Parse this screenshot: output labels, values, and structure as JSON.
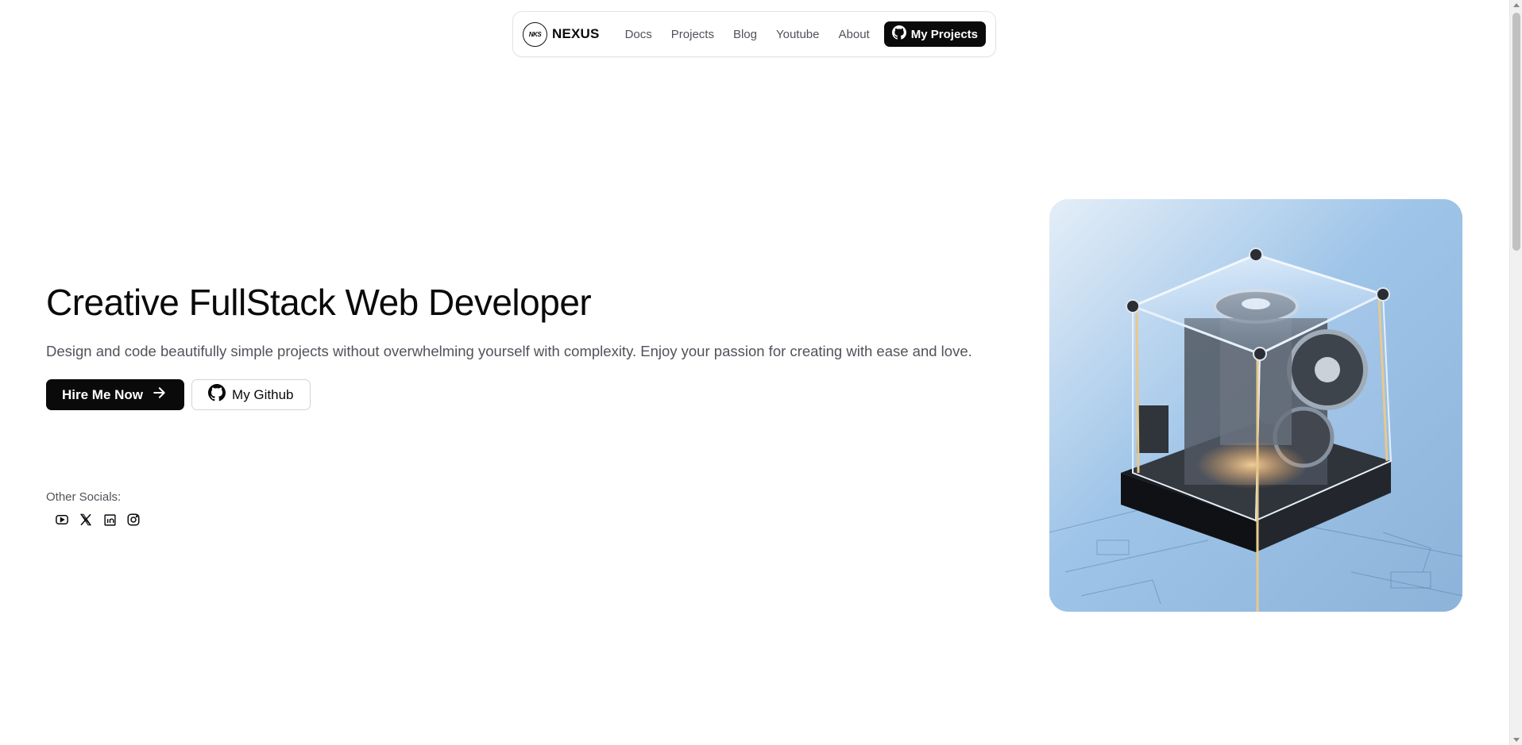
{
  "nav": {
    "brand_logo_text": "NKS",
    "brand_name": "NEXUS",
    "links": [
      {
        "label": "Docs"
      },
      {
        "label": "Projects"
      },
      {
        "label": "Blog"
      },
      {
        "label": "Youtube"
      },
      {
        "label": "About"
      }
    ],
    "cta_label": "My Projects",
    "cta_icon": "github-icon"
  },
  "hero": {
    "title": "Creative FullStack Web Developer",
    "subtitle": "Design and code beautifully simple projects without overwhelming yourself with complexity. Enjoy your passion for creating with ease and love.",
    "primary_button": "Hire Me Now",
    "primary_icon": "arrow-right-icon",
    "secondary_button": "My Github",
    "secondary_icon": "github-icon"
  },
  "socials": {
    "label": "Other Socials:",
    "icons": [
      "youtube-icon",
      "x-icon",
      "linkedin-icon",
      "instagram-icon"
    ]
  },
  "colors": {
    "primary": "#0a0a0a",
    "muted_text": "#52525b",
    "border": "#e4e4e7"
  }
}
